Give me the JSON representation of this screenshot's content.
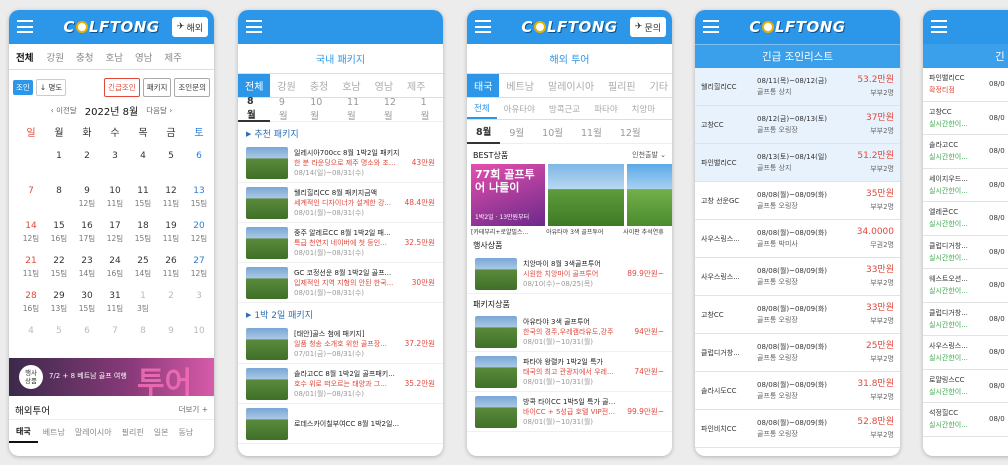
{
  "brand": {
    "logo": "COLFTONG",
    "logo_a": "C",
    "logo_b": "LFTONG",
    "accent": "#2c97e8",
    "sale": "#e2473b"
  },
  "s1": {
    "overseas_btn": "해외",
    "tab_all": "전체",
    "regions": [
      "강원",
      "충청",
      "호남",
      "영남",
      "제주"
    ],
    "sort_join": "조인",
    "sort_order": "↓ 명도",
    "btn_urgent": "긴급조인",
    "btn_package": "패키지",
    "btn_inquiry": "조인문의",
    "prev": "이전달",
    "next": "다음달",
    "month": "2022년 8월",
    "weekdays": [
      "일",
      "월",
      "화",
      "수",
      "목",
      "금",
      "토"
    ],
    "days": [
      {
        "d": "",
        "t": ""
      },
      {
        "d": "1",
        "t": ""
      },
      {
        "d": "2",
        "t": ""
      },
      {
        "d": "3",
        "t": ""
      },
      {
        "d": "4",
        "t": ""
      },
      {
        "d": "5",
        "t": ""
      },
      {
        "d": "6",
        "t": ""
      },
      {
        "d": "7",
        "t": ""
      },
      {
        "d": "8",
        "t": ""
      },
      {
        "d": "9",
        "t": "12팀"
      },
      {
        "d": "10",
        "t": "11팀"
      },
      {
        "d": "11",
        "t": "15팀"
      },
      {
        "d": "12",
        "t": "11팀"
      },
      {
        "d": "13",
        "t": "15팀"
      },
      {
        "d": "14",
        "t": "12팀"
      },
      {
        "d": "15",
        "t": "16팀"
      },
      {
        "d": "16",
        "t": "17팀"
      },
      {
        "d": "17",
        "t": "12팀"
      },
      {
        "d": "18",
        "t": "15팀"
      },
      {
        "d": "19",
        "t": "11팀"
      },
      {
        "d": "20",
        "t": "12팀"
      },
      {
        "d": "21",
        "t": "11팀"
      },
      {
        "d": "22",
        "t": "15팀"
      },
      {
        "d": "23",
        "t": "14팀"
      },
      {
        "d": "24",
        "t": "16팀"
      },
      {
        "d": "25",
        "t": "14팀"
      },
      {
        "d": "26",
        "t": "11팀"
      },
      {
        "d": "27",
        "t": "12팀"
      },
      {
        "d": "28",
        "t": "16팀"
      },
      {
        "d": "29",
        "t": "13팀"
      },
      {
        "d": "30",
        "t": "15팀"
      },
      {
        "d": "31",
        "t": "11팀"
      },
      {
        "d": "1",
        "t": "3팀"
      },
      {
        "d": "2",
        "t": ""
      },
      {
        "d": "3",
        "t": ""
      },
      {
        "d": "4",
        "t": ""
      },
      {
        "d": "5",
        "t": ""
      },
      {
        "d": "6",
        "t": ""
      },
      {
        "d": "7",
        "t": ""
      },
      {
        "d": "8",
        "t": ""
      },
      {
        "d": "9",
        "t": ""
      },
      {
        "d": "10",
        "t": ""
      }
    ],
    "banner_badge": "행사\n상품",
    "banner_text": "7/2 + 8 베트남 골프 여행",
    "banner_big": "투어",
    "overseas_title": "해외투어",
    "more": "더보기 +",
    "tabs": [
      "태국",
      "베트남",
      "말레이시아",
      "필리핀",
      "일본",
      "동남"
    ]
  },
  "s2": {
    "title": "국내 패키지",
    "tabs": [
      "전체",
      "강원",
      "충청",
      "호남",
      "영남",
      "제주"
    ],
    "months": [
      "8월",
      "9월",
      "10월",
      "11월",
      "12월",
      "1월"
    ],
    "sec1": "추천 패키지",
    "sec2": "1박 2일 패키지",
    "items": [
      {
        "a": "일레시아700cc 8월 1박2일 패키지",
        "b": "한 분 라운딩으로 제주 명소와 조...",
        "c": "08/14(일)~08/31(수)",
        "p": "43만원"
      },
      {
        "a": "웰리힐리CC 8월 패키지금액",
        "b": "세계적인 디자이너가 설계한 강...",
        "c": "08/01(월)~08/31(수)",
        "p": "48.4만원"
      },
      {
        "a": "중주 알레르CC 8월 1박2일 패...",
        "b": "특급 천연지 네이버에 첫 등인...",
        "c": "08/01(월)~08/31(수)",
        "p": "32.5만원"
      },
      {
        "a": "GC 코정선운 8월 1박2일 골프...",
        "b": "입제적인 지역 지형의 안된 한국...",
        "c": "08/01(월)~08/31(수)",
        "p": "30만원"
      },
      {
        "a": "[태안]골스 첨에 패키지]",
        "b": "일품 청송 소개호 위한 골프장...",
        "c": "07/01(금)~08/31(수)",
        "p": "37.2만원"
      },
      {
        "a": "솔라고CC 8월 1박2일 골프패키...",
        "b": "호수 위로 떠오르는 태양과 그...",
        "c": "08/01(월)~08/31(수)",
        "p": "35.2만원"
      },
      {
        "a": "로데스카이칠부여CC 8월 1박2일...",
        "b": "",
        "c": "",
        "p": ""
      }
    ]
  },
  "s3": {
    "title": "해외 투어",
    "inquiry": "문의",
    "tabs": [
      "태국",
      "베트남",
      "말레이시아",
      "필리핀",
      "기타"
    ],
    "subtabs": [
      "전체",
      "아유타야",
      "방콕근교",
      "파타야",
      "치앙마"
    ],
    "months": [
      "8월",
      "9월",
      "10월",
      "11월",
      "12월"
    ],
    "best": "BEST상품",
    "sort": "인천출발",
    "event": "행사상품",
    "package": "패키지상품",
    "best_items": [
      "[카테부리+로얄빌스...",
      "아유타야 3색 골프투어",
      "사이판 추석연휴"
    ],
    "banner_big": "77회 골프투어 나들이",
    "banner_sub": "1박2일 · 13만원부터",
    "items": [
      {
        "a": "치앙마이 8월 3색골프투어",
        "b": "시원한 치앙마이 골프투어",
        "c": "08/10(수)~08/25(목)",
        "p": "89.9만원~"
      },
      {
        "a": "아유타야 3색 골프투어",
        "b": "한국의 경주,우레캠라유도,강주",
        "c": "08/01(월)~10/31(월)",
        "p": "94만원~"
      },
      {
        "a": "파타야 왕렬카 1박2일 특가",
        "b": "태국의 최고 관광지에서 우레...",
        "c": "08/01(월)~10/31(월)",
        "p": "74만원~"
      },
      {
        "a": "방콕 타이CC 1박5일 특가 골프...",
        "b": "바이CC + 5성급 호텔 VIP전용기...",
        "c": "08/01(월)~10/31(월)",
        "p": "99.9만원~"
      }
    ]
  },
  "s4": {
    "title": "긴급 조인리스트",
    "rows": [
      {
        "n": "웰리힐리CC",
        "d": "08/11(목)~08/12(금)",
        "s": "골프통 상지",
        "v": "53.2만원",
        "k": "부부2명",
        "hl": true
      },
      {
        "n": "고창CC",
        "d": "08/12(금)~08/13(토)",
        "s": "골프통 오링장",
        "v": "37만원",
        "k": "부부2명",
        "hl": true
      },
      {
        "n": "파인밸리CC",
        "d": "08/13(토)~08/14(일)",
        "s": "골프통 상지",
        "v": "51.2만원",
        "k": "부부2명",
        "hl": true
      },
      {
        "n": "고창 선운GC",
        "d": "08/08(월)~08/09(화)",
        "s": "골프통 오링장",
        "v": "35만원",
        "k": "부부2명",
        "hl": false
      },
      {
        "n": "사우스링스...",
        "d": "08/08(월)~08/09(화)",
        "s": "골프통 박미사",
        "v": "34.0000",
        "k": "무권2명",
        "hl": false
      },
      {
        "n": "사우스링스...",
        "d": "08/08(월)~08/09(화)",
        "s": "골프통 오링장",
        "v": "33만원",
        "k": "부부2명",
        "hl": false
      },
      {
        "n": "고창CC",
        "d": "08/08(월)~08/09(화)",
        "s": "골프통 오링장",
        "v": "33만원",
        "k": "부부2명",
        "hl": false
      },
      {
        "n": "클럽디거창...",
        "d": "08/08(월)~08/09(화)",
        "s": "골프통 오링장",
        "v": "25만원",
        "k": "부부2명",
        "hl": false
      },
      {
        "n": "솔라시도CC",
        "d": "08/08(월)~08/09(화)",
        "s": "골프통 오링장",
        "v": "31.8만원",
        "k": "부부2명",
        "hl": false
      },
      {
        "n": "파인비치CC",
        "d": "08/08(월)~08/09(화)",
        "s": "골프통 오링장",
        "v": "52.8만원",
        "k": "부부2명",
        "hl": false
      }
    ]
  },
  "s5": {
    "title_cut": "긴",
    "rows": [
      {
        "n": "파인밸리CC",
        "s": "확정티점"
      },
      {
        "n": "고창CC",
        "s": "실시간한이..."
      },
      {
        "n": "솔라고CC",
        "s": "실시간한이..."
      },
      {
        "n": "세이지우드...",
        "s": "실시간한이..."
      },
      {
        "n": "엘레콘CC",
        "s": "실시간한이..."
      },
      {
        "n": "클럽디거창...",
        "s": "실시간한이..."
      },
      {
        "n": "웨스트오션...",
        "s": "실시간한이..."
      },
      {
        "n": "클럽디거창...",
        "s": "실시간한이..."
      },
      {
        "n": "사우스링스...",
        "s": "실시간한이..."
      },
      {
        "n": "로얄링스CC",
        "s": "실시간한이..."
      },
      {
        "n": "석정힐CC",
        "s": "실시간한이..."
      }
    ],
    "d_cut": "08/0"
  }
}
